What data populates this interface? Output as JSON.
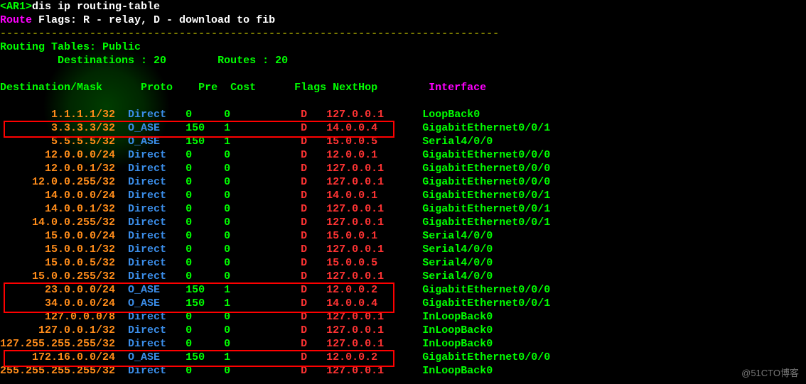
{
  "prompt": {
    "host": "<AR1>",
    "command": "dis ip routing-table"
  },
  "flags_line": {
    "label": "Route Flags:",
    "desc": " R - relay, D - download to fib"
  },
  "separator": "------------------------------------------------------------------------------",
  "summary": {
    "label": "Routing Tables: Public",
    "dest_label": "Destinations :",
    "dest_val": "20",
    "routes_label": "Routes :",
    "routes_val": "20"
  },
  "headers": {
    "dest": "Destination/Mask",
    "proto": "Proto",
    "pre": "Pre",
    "cost": "Cost",
    "flags": "Flags",
    "nexthop": "NextHop",
    "interface": "Interface"
  },
  "rows": [
    {
      "dest": "1.1.1.1/32",
      "proto": "Direct",
      "pre": "0",
      "cost": "0",
      "flags": "D",
      "nexthop": "127.0.0.1",
      "iface": "LoopBack0"
    },
    {
      "dest": "3.3.3.3/32",
      "proto": "O_ASE",
      "pre": "150",
      "cost": "1",
      "flags": "D",
      "nexthop": "14.0.0.4",
      "iface": "GigabitEthernet0/0/1"
    },
    {
      "dest": "5.5.5.5/32",
      "proto": "O_ASE",
      "pre": "150",
      "cost": "1",
      "flags": "D",
      "nexthop": "15.0.0.5",
      "iface": "Serial4/0/0"
    },
    {
      "dest": "12.0.0.0/24",
      "proto": "Direct",
      "pre": "0",
      "cost": "0",
      "flags": "D",
      "nexthop": "12.0.0.1",
      "iface": "GigabitEthernet0/0/0"
    },
    {
      "dest": "12.0.0.1/32",
      "proto": "Direct",
      "pre": "0",
      "cost": "0",
      "flags": "D",
      "nexthop": "127.0.0.1",
      "iface": "GigabitEthernet0/0/0"
    },
    {
      "dest": "12.0.0.255/32",
      "proto": "Direct",
      "pre": "0",
      "cost": "0",
      "flags": "D",
      "nexthop": "127.0.0.1",
      "iface": "GigabitEthernet0/0/0"
    },
    {
      "dest": "14.0.0.0/24",
      "proto": "Direct",
      "pre": "0",
      "cost": "0",
      "flags": "D",
      "nexthop": "14.0.0.1",
      "iface": "GigabitEthernet0/0/1"
    },
    {
      "dest": "14.0.0.1/32",
      "proto": "Direct",
      "pre": "0",
      "cost": "0",
      "flags": "D",
      "nexthop": "127.0.0.1",
      "iface": "GigabitEthernet0/0/1"
    },
    {
      "dest": "14.0.0.255/32",
      "proto": "Direct",
      "pre": "0",
      "cost": "0",
      "flags": "D",
      "nexthop": "127.0.0.1",
      "iface": "GigabitEthernet0/0/1"
    },
    {
      "dest": "15.0.0.0/24",
      "proto": "Direct",
      "pre": "0",
      "cost": "0",
      "flags": "D",
      "nexthop": "15.0.0.1",
      "iface": "Serial4/0/0"
    },
    {
      "dest": "15.0.0.1/32",
      "proto": "Direct",
      "pre": "0",
      "cost": "0",
      "flags": "D",
      "nexthop": "127.0.0.1",
      "iface": "Serial4/0/0"
    },
    {
      "dest": "15.0.0.5/32",
      "proto": "Direct",
      "pre": "0",
      "cost": "0",
      "flags": "D",
      "nexthop": "15.0.0.5",
      "iface": "Serial4/0/0"
    },
    {
      "dest": "15.0.0.255/32",
      "proto": "Direct",
      "pre": "0",
      "cost": "0",
      "flags": "D",
      "nexthop": "127.0.0.1",
      "iface": "Serial4/0/0"
    },
    {
      "dest": "23.0.0.0/24",
      "proto": "O_ASE",
      "pre": "150",
      "cost": "1",
      "flags": "D",
      "nexthop": "12.0.0.2",
      "iface": "GigabitEthernet0/0/0"
    },
    {
      "dest": "34.0.0.0/24",
      "proto": "O_ASE",
      "pre": "150",
      "cost": "1",
      "flags": "D",
      "nexthop": "14.0.0.4",
      "iface": "GigabitEthernet0/0/1"
    },
    {
      "dest": "127.0.0.0/8",
      "proto": "Direct",
      "pre": "0",
      "cost": "0",
      "flags": "D",
      "nexthop": "127.0.0.1",
      "iface": "InLoopBack0"
    },
    {
      "dest": "127.0.0.1/32",
      "proto": "Direct",
      "pre": "0",
      "cost": "0",
      "flags": "D",
      "nexthop": "127.0.0.1",
      "iface": "InLoopBack0"
    },
    {
      "dest": "127.255.255.255/32",
      "proto": "Direct",
      "pre": "0",
      "cost": "0",
      "flags": "D",
      "nexthop": "127.0.0.1",
      "iface": "InLoopBack0"
    },
    {
      "dest": "172.16.0.0/24",
      "proto": "O_ASE",
      "pre": "150",
      "cost": "1",
      "flags": "D",
      "nexthop": "12.0.0.2",
      "iface": "GigabitEthernet0/0/0"
    },
    {
      "dest": "255.255.255.255/32",
      "proto": "Direct",
      "pre": "0",
      "cost": "0",
      "flags": "D",
      "nexthop": "127.0.0.1",
      "iface": "InLoopBack0"
    }
  ],
  "watermark": "@51CTO博客",
  "highlight_indexes": {
    "single_rows": [
      1,
      18
    ],
    "double_rows_start": 13
  }
}
